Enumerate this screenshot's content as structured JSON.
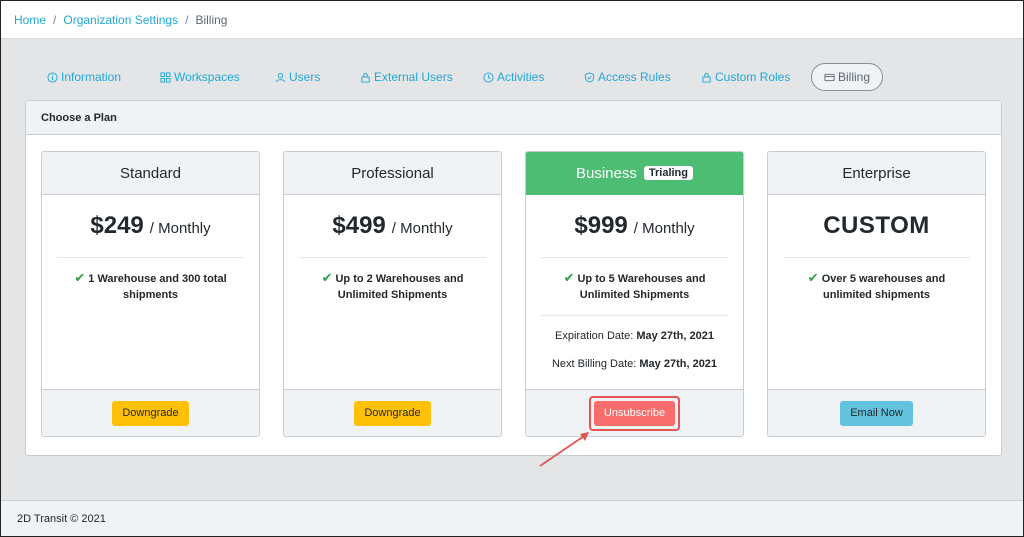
{
  "breadcrumb": {
    "items": [
      "Home",
      "Organization Settings",
      "Billing"
    ],
    "separator": "/"
  },
  "tabs": [
    {
      "label": "Information",
      "icon": "info-icon"
    },
    {
      "label": "Workspaces",
      "icon": "grid-icon"
    },
    {
      "label": "Users",
      "icon": "user-icon"
    },
    {
      "label": "External Users",
      "icon": "lock-icon"
    },
    {
      "label": "Activities",
      "icon": "clock-icon"
    },
    {
      "label": "Access Rules",
      "icon": "shield-icon"
    },
    {
      "label": "Custom Roles",
      "icon": "lock-icon"
    },
    {
      "label": "Billing",
      "icon": "credit-card-icon",
      "active": true
    }
  ],
  "card": {
    "title": "Choose a Plan"
  },
  "plans": [
    {
      "name": "Standard",
      "price": "$249",
      "period": "/ Monthly",
      "feature": "1 Warehouse and 300 total shipments",
      "button": "Downgrade"
    },
    {
      "name": "Professional",
      "price": "$499",
      "period": "/ Monthly",
      "feature": "Up to 2 Warehouses and Unlimited Shipments",
      "button": "Downgrade"
    },
    {
      "name": "Business",
      "badge": "Trialing",
      "price": "$999",
      "period": "/ Monthly",
      "feature": "Up to 5 Warehouses and Unlimited Shipments",
      "expiration_label": "Expiration Date:",
      "expiration_value": "May 27th, 2021",
      "next_billing_label": "Next Billing Date:",
      "next_billing_value": "May 27th, 2021",
      "button": "Unsubscribe"
    },
    {
      "name": "Enterprise",
      "price": "CUSTOM",
      "feature": "Over 5 warehouses and unlimited shipments",
      "button": "Email Now"
    }
  ],
  "footer": {
    "text": "2D Transit © 2021"
  },
  "colors": {
    "link": "#20a8d8",
    "trial_header": "#4dbd74",
    "downgrade": "#ffc107",
    "unsubscribe": "#f86c6b",
    "email": "#63c2de",
    "callout": "#e55353"
  }
}
